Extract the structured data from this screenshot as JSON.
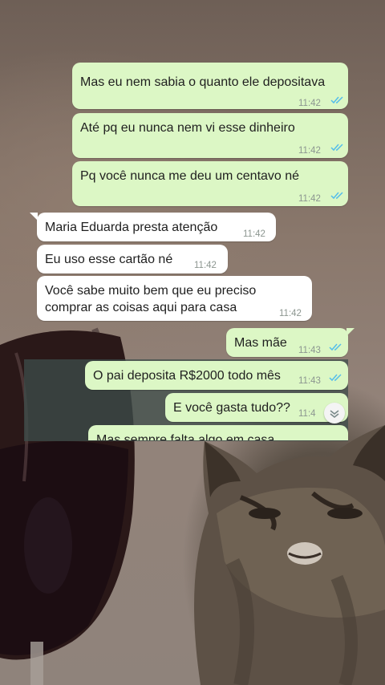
{
  "messages": [
    {
      "dir": "out",
      "text": "Mas eu nem sabia o quanto ele depositava",
      "time": "11:42",
      "read": true
    },
    {
      "dir": "out",
      "text": "Até pq eu nunca nem vi esse dinheiro",
      "time": "11:42",
      "read": true
    },
    {
      "dir": "out",
      "text": "Pq você nunca me deu um centavo né",
      "time": "11:42",
      "read": true
    },
    {
      "dir": "in",
      "text": "Maria Eduarda presta atenção",
      "time": "11:42"
    },
    {
      "dir": "in",
      "text": "Eu uso esse cartão né",
      "time": "11:42"
    },
    {
      "dir": "in",
      "text": "Você sabe muito bem que eu preciso comprar as coisas aqui para casa",
      "time": "11:42"
    },
    {
      "dir": "out",
      "text": "Mas mãe",
      "time": "11:43",
      "read": true
    },
    {
      "dir": "out",
      "text": "O pai deposita R$2000 todo mês",
      "time": "11:43",
      "read": true
    },
    {
      "dir": "out",
      "text": "E você gasta tudo??",
      "time": "11:4",
      "read": true
    },
    {
      "dir": "out",
      "text": "Mas sempre falta algo em casa",
      "time": "",
      "read": false
    }
  ],
  "colors": {
    "outgoing_bubble": "#dcf7c5",
    "incoming_bubble": "#ffffff",
    "read_ticks": "#53bdeb"
  },
  "icons": {
    "read_receipt": "double-check-icon",
    "scroll": "chevron-down-icon"
  }
}
